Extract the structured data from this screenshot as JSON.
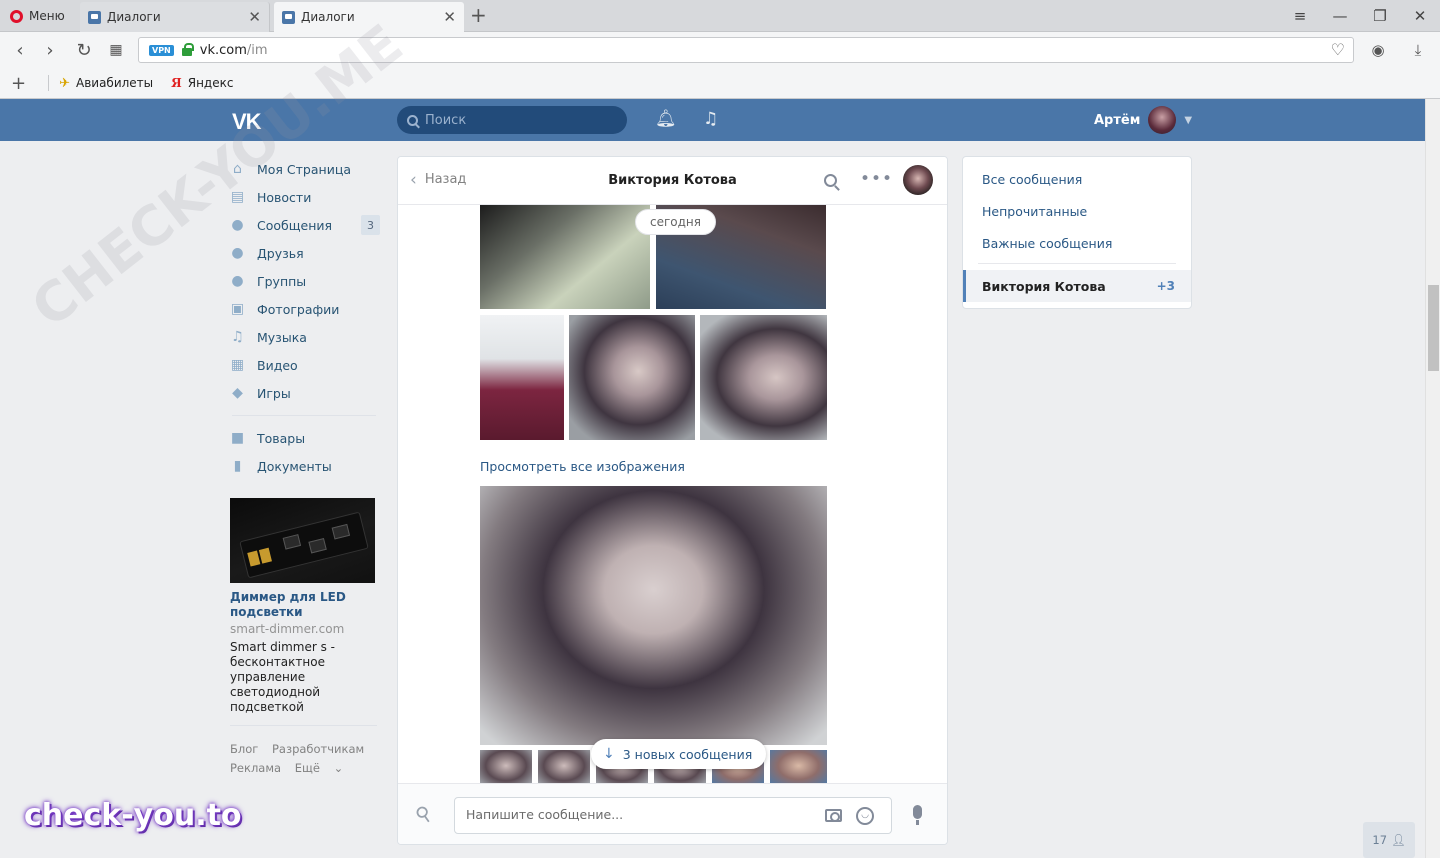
{
  "browser": {
    "menu_label": "Меню",
    "tabs": [
      {
        "title": "Диалоги",
        "active": false
      },
      {
        "title": "Диалоги",
        "active": true
      }
    ],
    "url_host": "vk.com",
    "url_path": "/im",
    "vpn_badge": "VPN",
    "bookmarks": [
      {
        "label": "Авиабилеты",
        "icon": "plane-icon"
      },
      {
        "label": "Яндекс",
        "icon": "yandex-icon"
      }
    ]
  },
  "header": {
    "logo": "VK",
    "search_placeholder": "Поиск",
    "user_name": "Артём"
  },
  "left_menu": {
    "items": [
      {
        "label": "Моя Страница",
        "icon": "home-icon",
        "badge": ""
      },
      {
        "label": "Новости",
        "icon": "news-icon",
        "badge": ""
      },
      {
        "label": "Сообщения",
        "icon": "messages-icon",
        "badge": "3"
      },
      {
        "label": "Друзья",
        "icon": "friends-icon",
        "badge": ""
      },
      {
        "label": "Группы",
        "icon": "groups-icon",
        "badge": ""
      },
      {
        "label": "Фотографии",
        "icon": "camera-icon",
        "badge": ""
      },
      {
        "label": "Музыка",
        "icon": "music-icon",
        "badge": ""
      },
      {
        "label": "Видео",
        "icon": "video-icon",
        "badge": ""
      },
      {
        "label": "Игры",
        "icon": "games-icon",
        "badge": ""
      }
    ],
    "extra_items": [
      {
        "label": "Товары",
        "icon": "bag-icon"
      },
      {
        "label": "Документы",
        "icon": "document-icon"
      }
    ],
    "ad": {
      "title": "Диммер для LED подсветки",
      "domain": "smart-dimmer.com",
      "description": "Smart dimmer s - бесконтактное управление светодиодной подсветкой"
    },
    "footer": [
      "Блог",
      "Разработчикам",
      "Реклама",
      "Ещё"
    ]
  },
  "chat": {
    "back_label": "Назад",
    "contact_name": "Виктория Котова",
    "date_label": "сегодня",
    "view_all_label": "Просмотреть все изображения",
    "new_messages_label": "3 новых сообщения",
    "input_placeholder": "Напишите сообщение..."
  },
  "right_panel": {
    "filters": [
      "Все сообщения",
      "Непрочитанные",
      "Важные сообщения"
    ],
    "dialog": {
      "name": "Виктория Котова",
      "count": "+3"
    }
  },
  "online_counter": "17",
  "watermark": {
    "diagonal": "CHECK-YOU.ME",
    "corner": "check-you.to"
  },
  "colors": {
    "vk_blue": "#4a76a8",
    "link": "#2a5885",
    "page_bg": "#edeef0"
  }
}
